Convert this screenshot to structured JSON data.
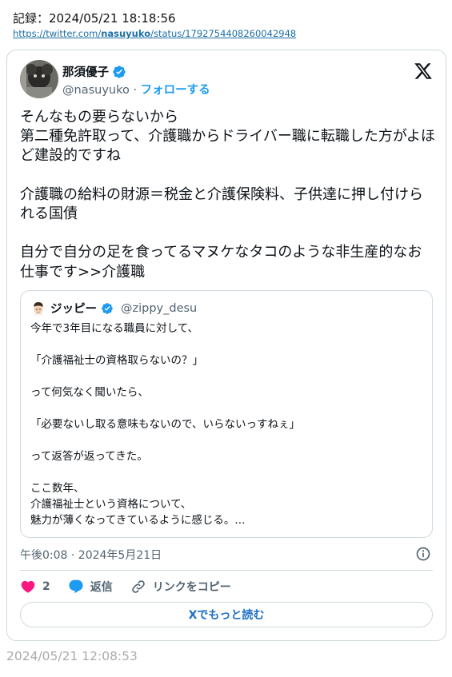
{
  "record": {
    "label": "記録：2024/05/21 18:18:56",
    "url_prefix": "https://twitter.com/",
    "url_user": "nasuyuko",
    "url_suffix": "/status/1792754408260042948"
  },
  "tweet": {
    "author_name": "那須優子",
    "handle": "@nasuyuko",
    "separator": " · ",
    "follow_label": "フォローする",
    "text": "そんなもの要らないから\n第二種免許取って、介護職からドライバー職に転職した方がよほど建設的ですね\n\n介護職の給料の財源＝税金と介護保険料、子供達に押し付けられる国債\n\n自分で自分の足を食ってるマヌケなタコのような非生産的なお仕事です>>介護職",
    "timestamp": "午後0:08 · 2024年5月21日",
    "like_count": "2",
    "reply_label": "返信",
    "copy_link_label": "リンクをコピー",
    "read_more_label": "Xでもっと読む"
  },
  "quote": {
    "author_name": "ジッピー",
    "handle": "@zippy_desu",
    "text": "今年で3年目になる職員に対して、\n\n「介護福祉士の資格取らないの？」\n\nって何気なく聞いたら、\n\n「必要ないし取る意味もないので、いらないっすねぇ」\n\nって返答が返ってきた。\n\nここ数年、\n介護福祉士という資格について、\n魅力が薄くなってきているように感じる。..."
  },
  "footer": {
    "captured_time": "2024/05/21 12:08:53"
  },
  "colors": {
    "accent": "#1d9bf0",
    "like": "#f91880",
    "border": "#cfd9de",
    "muted": "#536471"
  },
  "icons": [
    "verified-badge-icon",
    "x-logo-icon",
    "info-icon",
    "heart-icon",
    "reply-bubble-icon",
    "link-icon"
  ]
}
